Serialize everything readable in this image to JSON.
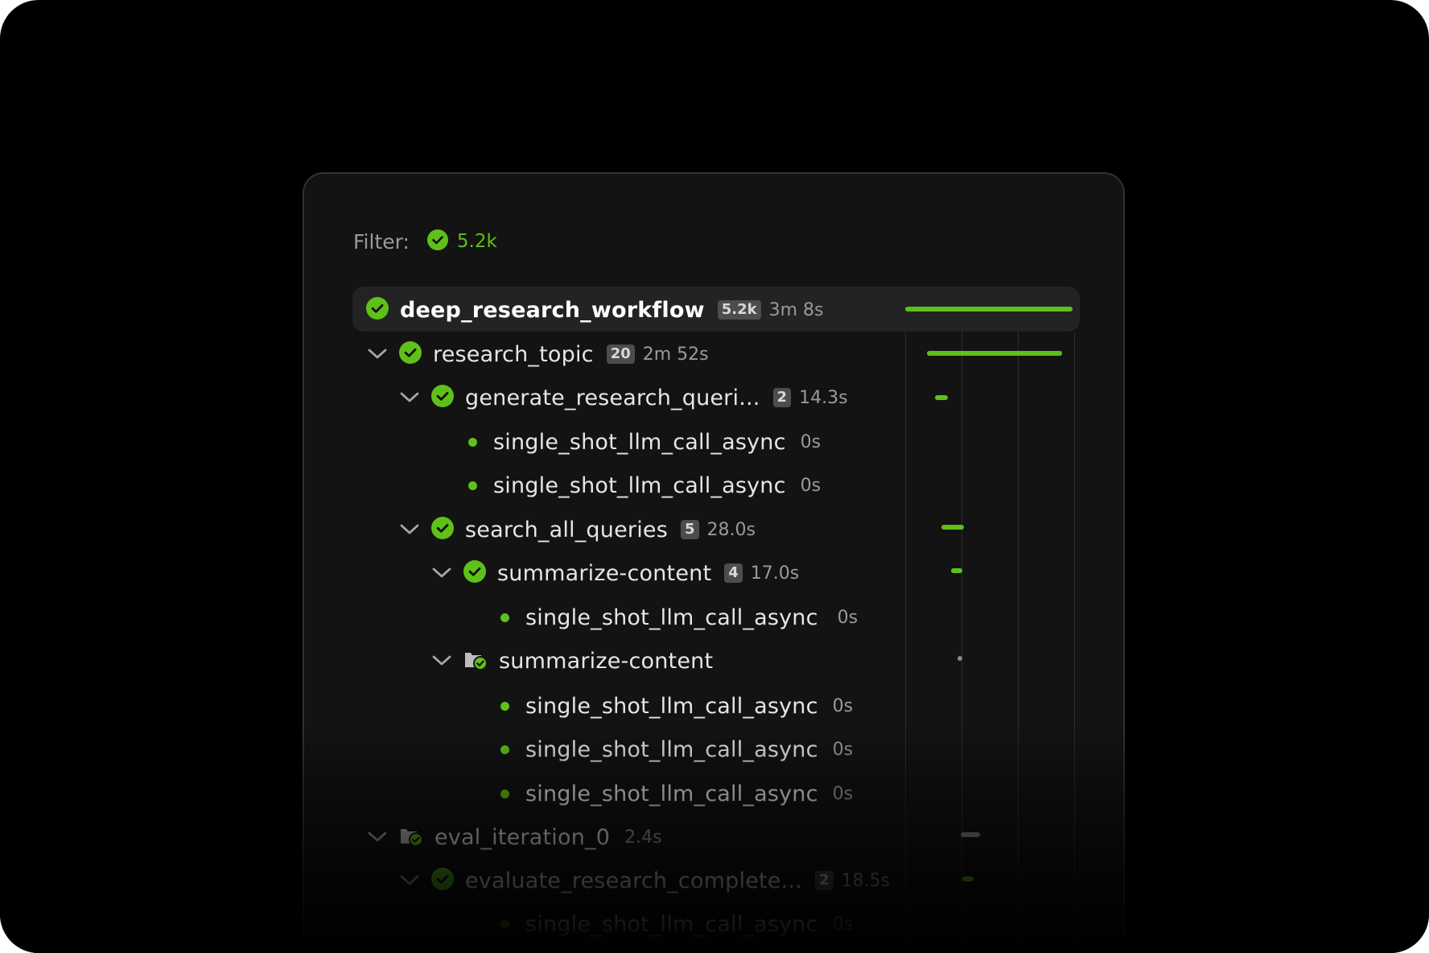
{
  "filter": {
    "label": "Filter:",
    "count": "5.2k"
  },
  "colors": {
    "success": "#5fc01a",
    "pending": "#8a8a8a",
    "background": "#000000",
    "panel": "#131313"
  },
  "rows": [
    {
      "name": "deep_research_workflow",
      "badge": "5.2k",
      "duration": "3m 8s",
      "status": "success-icon",
      "selected": true
    },
    {
      "name": "research_topic",
      "badge": "20",
      "duration": "2m 52s",
      "status": "success-icon"
    },
    {
      "name": "generate_research_queri...",
      "badge": "2",
      "duration": "14.3s",
      "status": "success-icon"
    },
    {
      "name": "single_shot_llm_call_async",
      "duration": "0s",
      "status": "dot"
    },
    {
      "name": "single_shot_llm_call_async",
      "duration": "0s",
      "status": "dot"
    },
    {
      "name": "search_all_queries",
      "badge": "5",
      "duration": "28.0s",
      "status": "success-icon"
    },
    {
      "name": "summarize-content",
      "badge": "4",
      "duration": "17.0s",
      "status": "success-icon"
    },
    {
      "name": "single_shot_llm_call_async",
      "duration": "0s",
      "status": "dot"
    },
    {
      "name": "summarize-content",
      "status": "folder-check-icon"
    },
    {
      "name": "single_shot_llm_call_async",
      "duration": "0s",
      "status": "dot"
    },
    {
      "name": "single_shot_llm_call_async",
      "duration": "0s",
      "status": "dot"
    },
    {
      "name": "single_shot_llm_call_async",
      "duration": "0s",
      "status": "dot"
    },
    {
      "name": "eval_iteration_0",
      "duration": "2.4s",
      "status": "folder-check-icon"
    },
    {
      "name": "evaluate_research_complete...",
      "badge": "2",
      "duration": "18.5s",
      "status": "success-icon"
    },
    {
      "name": "single_shot_llm_call_async",
      "duration": "0s",
      "status": "dot"
    }
  ]
}
